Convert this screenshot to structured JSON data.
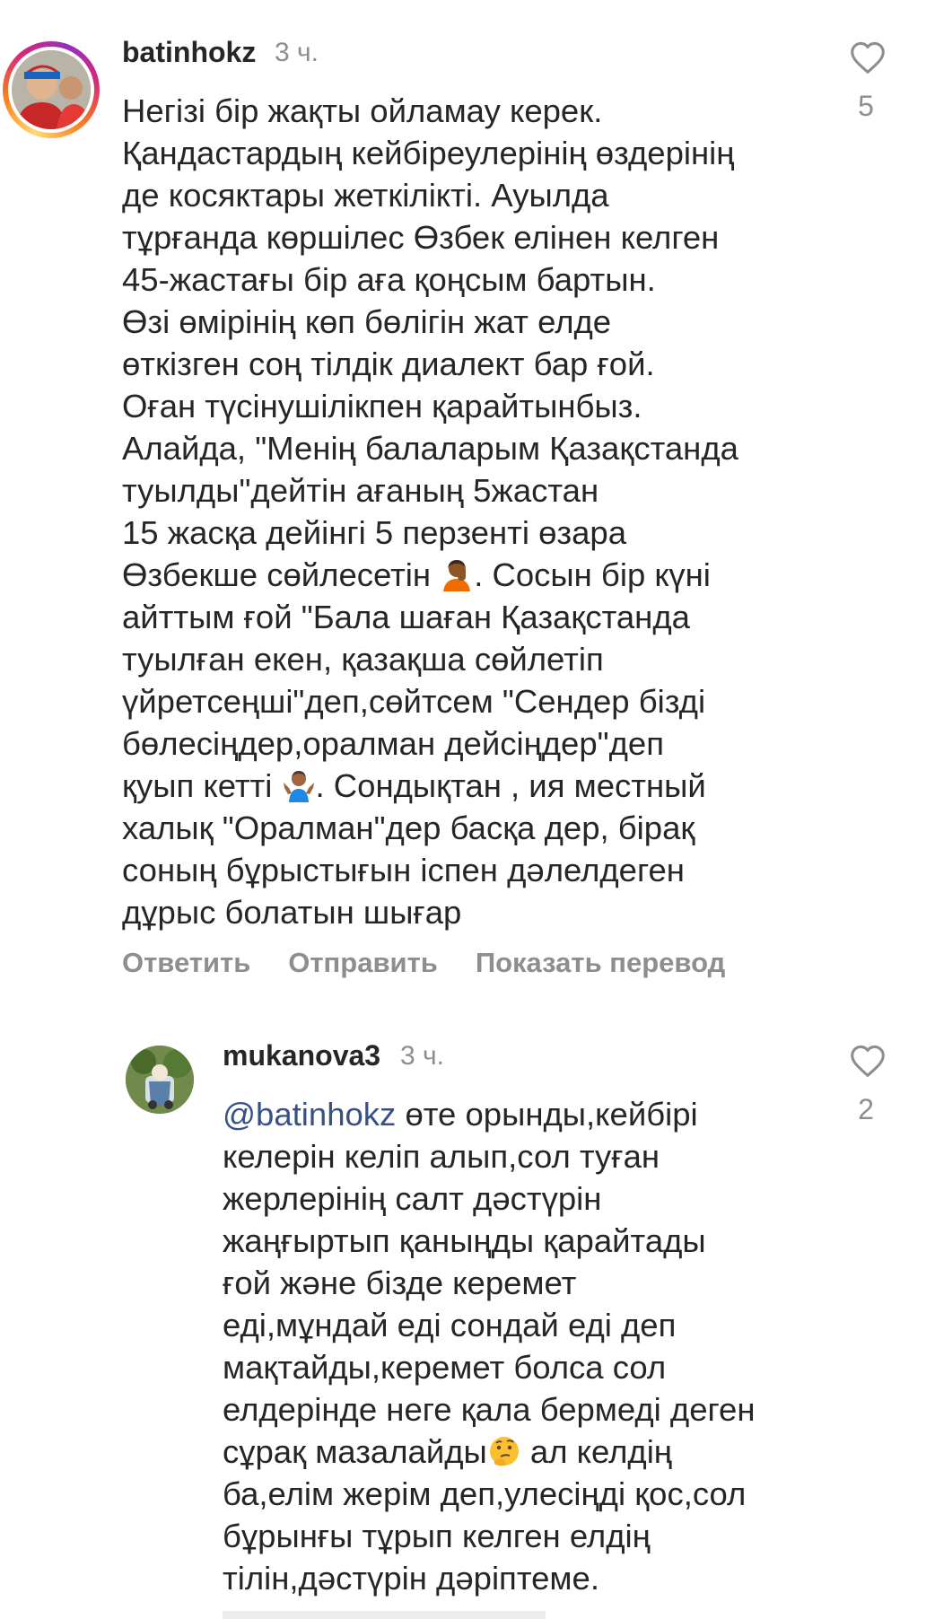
{
  "comments": [
    {
      "username": "batinhokz",
      "time": "3 ч.",
      "likes": "5",
      "text_parts": [
        "Негізі бір жақты ойламау керек.\nҚандастардың кейбіреулерінің өздерінің\nде косяктары жеткілікті. Ауылда\nтұрғанда көршілес Өзбек елінен келген\n45-жастағы бір аға қоңсым бартын.\nӨзі өмірінің көп бөлігін жат елде\nөткізген соң тілдік диалект бар ғой.\nОған түсінушілікпен қарайтынбыз.\nАлайда, \"Менің балаларым Қазақстанда\nтуылды\"дейтін ағаның 5жастан\n15 жасқа дейінгі 5 перзенті өзара\nӨзбекше сөйлесетін ",
        ". Сосын бір күні\nайттым ғой \"Бала шаған Қазақстанда\nтуылған екен, қазақша сөйлетіп\nүйретсеңші\"деп,сөйтсем \"Сендер бізді\nбөлесіңдер,оралман дейсіңдер\"деп\nқуып кетті ",
        ". Сондықтан , ия местный\nхалық \"Оралман\"дер басқа дер, бірақ\nсоның бұрыстығын іспен дәлелдеген\nдұрыс болатын шығар"
      ],
      "emojis": [
        "person-facepalming-emoji",
        "person-shrugging-emoji"
      ],
      "actions": {
        "reply": "Ответить",
        "send": "Отправить",
        "translate": "Показать перевод"
      }
    },
    {
      "username": "mukanova3",
      "time": "3 ч.",
      "likes": "2",
      "mention": "@batinhokz",
      "text_parts": [
        " өте орынды,кейбірі\nкелерін келіп алып,сол туған\nжерлерінің салт дәстүрін\nжаңғыртып қаныңды қарайтады\nғой және бізде керемет\nеді,мұндай еді сондай еді деп\nмақтайды,керемет болса сол\nелдерінде неге қала бермеді деген\nсұрақ мазалайды",
        " ал келдің\nба,елім жерім деп,улесіңді қос,сол\nбұрынғы тұрып келген елдің\nтілін,дәстүрін дәріптеме."
      ],
      "emojis": [
        "thinking-face-emoji"
      ]
    }
  ],
  "colors": {
    "text": "#262626",
    "secondary": "#8e8e8e",
    "mention": "#385185"
  }
}
